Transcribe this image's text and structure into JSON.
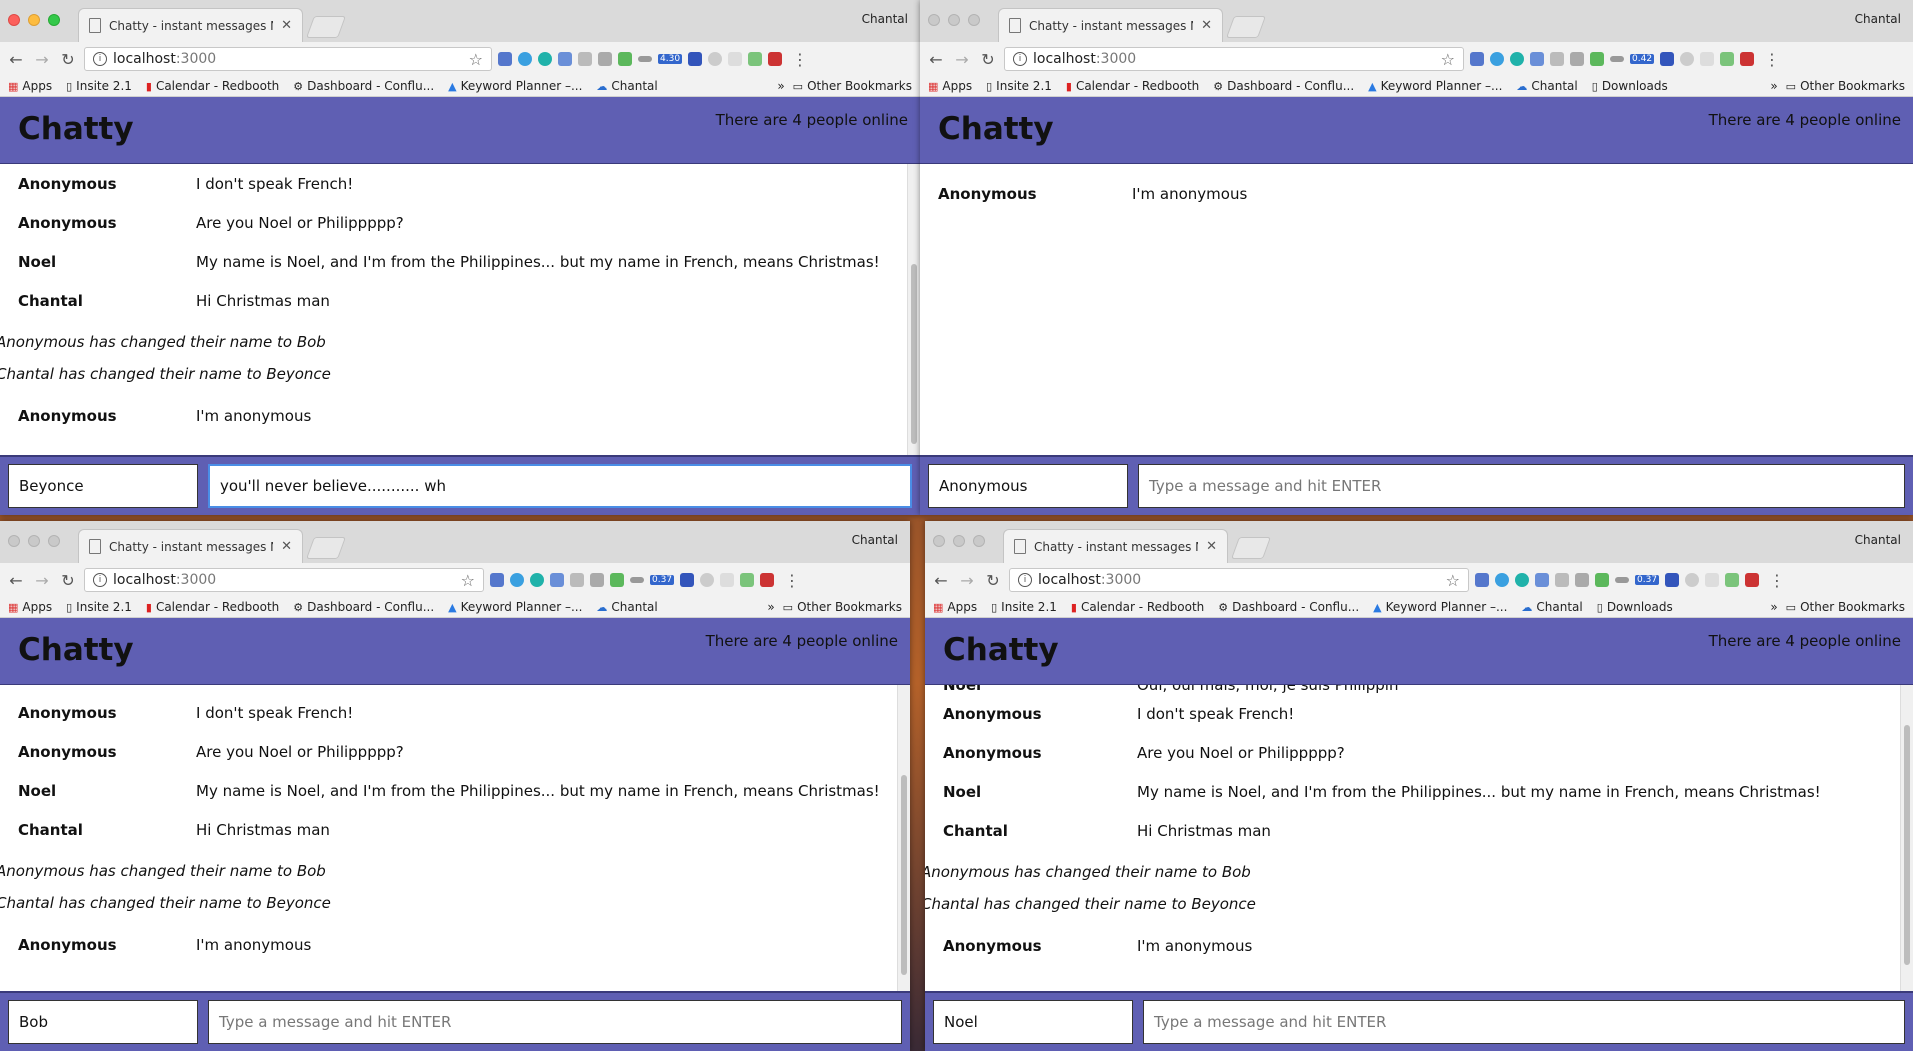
{
  "windows": {
    "tl": {
      "tab_title": "Chatty - instant messages NO",
      "profile": "Chantal",
      "url_host": "localhost",
      "url_port": ":3000",
      "badge": "4.30",
      "bookmarks": [
        "Apps",
        "Insite 2.1",
        "Calendar - Redbooth",
        "Dashboard - Conflu...",
        "Keyword Planner –...",
        "Chantal"
      ],
      "other_bookmarks": "Other Bookmarks",
      "brand": "Chatty",
      "online": "There are 4 people online",
      "messages": [
        {
          "user": "Anonymous",
          "content": "I don't speak French!"
        },
        {
          "user": "Anonymous",
          "content": "Are you Noel or Philippppp?"
        },
        {
          "user": "Noel",
          "content": "My name is Noel, and I'm from the Philippines... but my name in French, means Christmas!"
        },
        {
          "user": "Chantal",
          "content": "Hi Christmas man"
        }
      ],
      "system": [
        "Anonymous has changed their name to Bob",
        "Chantal has changed their name to Beyonce"
      ],
      "last": {
        "user": "Anonymous",
        "content": "I'm anonymous"
      },
      "name_value": "Beyonce",
      "message_value": "you'll never believe........... wh"
    },
    "tr": {
      "tab_title": "Chatty - instant messages NO",
      "profile": "Chantal",
      "url_host": "localhost",
      "url_port": ":3000",
      "badge": "0.42",
      "bookmarks": [
        "Apps",
        "Insite 2.1",
        "Calendar - Redbooth",
        "Dashboard - Conflu...",
        "Keyword Planner –...",
        "Chantal",
        "Downloads"
      ],
      "other_bookmarks": "Other Bookmarks",
      "brand": "Chatty",
      "online": "There are 4 people online",
      "last": {
        "user": "Anonymous",
        "content": "I'm anonymous"
      },
      "name_value": "Anonymous",
      "message_placeholder": "Type a message and hit ENTER"
    },
    "bl": {
      "tab_title": "Chatty - instant messages NO",
      "profile": "Chantal",
      "url_host": "localhost",
      "url_port": ":3000",
      "badge": "0.37",
      "bookmarks": [
        "Apps",
        "Insite 2.1",
        "Calendar - Redbooth",
        "Dashboard - Conflu...",
        "Keyword Planner –...",
        "Chantal"
      ],
      "other_bookmarks": "Other Bookmarks",
      "brand": "Chatty",
      "online": "There are 4 people online",
      "messages": [
        {
          "user": "Anonymous",
          "content": "I don't speak French!"
        },
        {
          "user": "Anonymous",
          "content": "Are you Noel or Philippppp?"
        },
        {
          "user": "Noel",
          "content": "My name is Noel, and I'm from the Philippines... but my name in French, means Christmas!"
        },
        {
          "user": "Chantal",
          "content": "Hi Christmas man"
        }
      ],
      "system": [
        "Anonymous has changed their name to Bob",
        "Chantal has changed their name to Beyonce"
      ],
      "last": {
        "user": "Anonymous",
        "content": "I'm anonymous"
      },
      "name_value": "Bob",
      "message_placeholder": "Type a message and hit ENTER"
    },
    "br": {
      "tab_title": "Chatty - instant messages NO",
      "profile": "Chantal",
      "url_host": "localhost",
      "url_port": ":3000",
      "badge": "0.37",
      "bookmarks": [
        "Apps",
        "Insite 2.1",
        "Calendar - Redbooth",
        "Dashboard - Conflu...",
        "Keyword Planner –...",
        "Chantal",
        "Downloads"
      ],
      "other_bookmarks": "Other Bookmarks",
      "brand": "Chatty",
      "online": "There are 4 people online",
      "partial": {
        "user": "Noel",
        "content": "Oui, oui mais, moi, je suis Philippin"
      },
      "messages": [
        {
          "user": "Anonymous",
          "content": "I don't speak French!"
        },
        {
          "user": "Anonymous",
          "content": "Are you Noel or Philippppp?"
        },
        {
          "user": "Noel",
          "content": "My name is Noel, and I'm from the Philippines... but my name in French, means Christmas!"
        },
        {
          "user": "Chantal",
          "content": "Hi Christmas man"
        }
      ],
      "system": [
        "Anonymous has changed their name to Bob",
        "Chantal has changed their name to Beyonce"
      ],
      "last": {
        "user": "Anonymous",
        "content": "I'm anonymous"
      },
      "name_value": "Noel",
      "message_placeholder": "Type a message and hit ENTER"
    }
  },
  "icons": {
    "back": "back-arrow-icon",
    "forward": "forward-arrow-icon",
    "reload": "reload-icon",
    "info": "info-icon",
    "star": "star-icon",
    "menu": "kebab-menu-icon",
    "doc": "document-icon",
    "folder": "folder-icon"
  },
  "colors": {
    "brand": "#5f5fb3",
    "focus": "#4a8ee6",
    "titlebar": "#dadada"
  }
}
